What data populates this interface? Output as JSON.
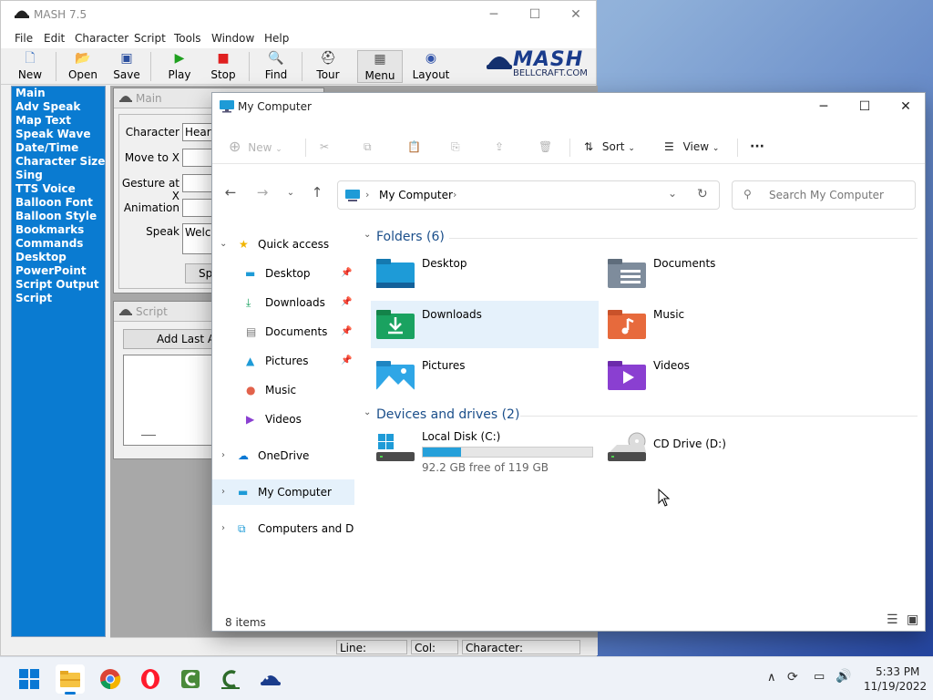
{
  "mash": {
    "title": "MASH 7.5",
    "menu": [
      "File",
      "Edit",
      "Character",
      "Script",
      "Tools",
      "Window",
      "Help"
    ],
    "toolbar": [
      "New",
      "Open",
      "Save",
      "Play",
      "Stop",
      "Find",
      "Tour",
      "Menu",
      "Layout"
    ],
    "logo": {
      "text": "MASH",
      "sub": "BELLCRAFT.COM"
    },
    "sidebar": [
      "Main",
      "Adv Speak",
      "Map Text",
      "Speak Wave",
      "Date/Time",
      "Character Size",
      "Sing",
      "TTS Voice",
      "Balloon Font",
      "Balloon Style",
      "Bookmarks",
      "Commands",
      "Desktop",
      "PowerPoint",
      "Script Output",
      "Script"
    ],
    "main_panel": {
      "title": "Main",
      "character_label": "Character",
      "character_value": "Hearty",
      "moveto_label": "Move to X",
      "gesture_label": "Gesture at X",
      "animation_label": "Animation",
      "speak_label": "Speak",
      "speak_value": "Welco",
      "speak_button": "Spea"
    },
    "script_panel": {
      "title": "Script",
      "add_button": "Add Last Act"
    },
    "status": {
      "line": "Line:",
      "col": "Col:",
      "character": "Character:"
    }
  },
  "explorer": {
    "title": "My Computer",
    "cmd": {
      "new": "New",
      "sort": "Sort",
      "view": "View",
      "more": "···"
    },
    "address": "My Computer",
    "search_placeholder": "Search My Computer",
    "tree": {
      "quick_access": "Quick access",
      "desktop": "Desktop",
      "downloads": "Downloads",
      "documents": "Documents",
      "pictures": "Pictures",
      "music": "Music",
      "videos": "Videos",
      "onedrive": "OneDrive",
      "mycomputer": "My Computer",
      "network": "Computers and Dev"
    },
    "folders_header": "Folders (6)",
    "folders": [
      "Desktop",
      "Documents",
      "Downloads",
      "Music",
      "Pictures",
      "Videos"
    ],
    "drives_header": "Devices and drives (2)",
    "drive_c": {
      "name": "Local Disk (C:)",
      "free": "92.2 GB free of 119 GB",
      "used_fraction": 0.225
    },
    "drive_d": {
      "name": "CD Drive (D:)"
    },
    "status": "8 items"
  },
  "taskbar": {
    "time": "5:33 PM",
    "date": "11/19/2022"
  },
  "colors": {
    "mash_sidebar": "#0a7bd1",
    "selection": "#e5f1fb",
    "accent": "#0a78d4"
  }
}
